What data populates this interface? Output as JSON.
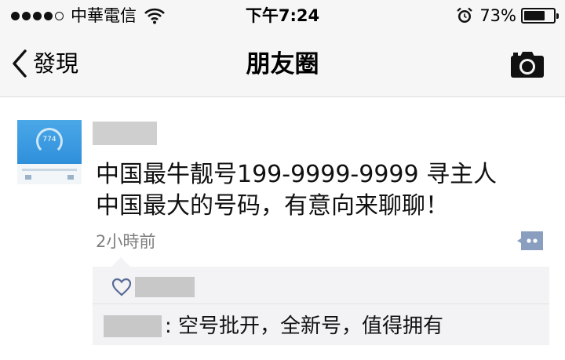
{
  "status_bar": {
    "carrier": "中華電信",
    "time": "下午7:24",
    "battery_percent": "73%",
    "battery_level": 0.73,
    "signal_bars_filled": 4,
    "signal_bars_total": 5
  },
  "nav": {
    "back_label": "發現",
    "title": "朋友圈"
  },
  "post": {
    "lines": [
      "中国最牛靓号199-9999-9999 寻主人",
      "中国最大的号码，有意向来聊聊！"
    ],
    "time_ago": "2小時前",
    "avatar_score": "774",
    "comment": {
      "text": ": 空号批开，全新号，值得拥有"
    }
  },
  "colors": {
    "link_blue": "#576b95",
    "bar_bg": "#f6f6f6",
    "comment_bg": "#f3f3f5"
  },
  "icons": {
    "wifi": "wifi-icon",
    "alarm": "alarm-clock-icon",
    "back": "chevron-left-icon",
    "camera": "camera-icon",
    "comment": "comment-bubble-icon",
    "like": "heart-icon"
  }
}
